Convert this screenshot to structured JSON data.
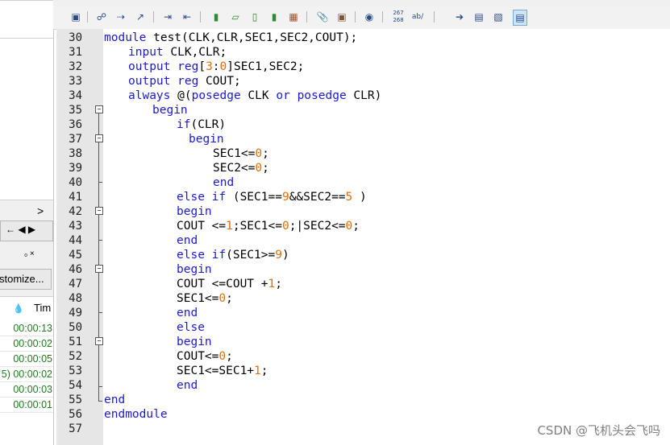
{
  "left_panel": {
    "scroll_arrow": ">",
    "panel_controls": "← ◀ ▶",
    "pin_close": "₀ ×",
    "customize_label": "stomize...",
    "column_header": "Tim",
    "times": [
      "00:00:13",
      "00:00:02",
      "00:00:05",
      "5) 00:00:02",
      "00:00:03",
      "00:00:01"
    ]
  },
  "code_lines": [
    {
      "n": "30",
      "indent": 0,
      "tokens": [
        [
          "kw",
          "module"
        ],
        [
          "t",
          " test(CLK,CLR,SEC1,SEC2,COUT);"
        ]
      ]
    },
    {
      "n": "31",
      "indent": 2,
      "tokens": [
        [
          "kw",
          "input"
        ],
        [
          "t",
          " CLK,CLR;"
        ]
      ]
    },
    {
      "n": "32",
      "indent": 2,
      "tokens": [
        [
          "kw",
          "output"
        ],
        [
          "t",
          " "
        ],
        [
          "kw",
          "reg"
        ],
        [
          "t",
          "["
        ],
        [
          "nm",
          "3"
        ],
        [
          "t",
          ":"
        ],
        [
          "nm",
          "0"
        ],
        [
          "t",
          "]SEC1,SEC2;"
        ]
      ]
    },
    {
      "n": "33",
      "indent": 2,
      "tokens": [
        [
          "kw",
          "output"
        ],
        [
          "t",
          " "
        ],
        [
          "kw",
          "reg"
        ],
        [
          "t",
          " COUT;"
        ]
      ]
    },
    {
      "n": "34",
      "indent": 2,
      "tokens": [
        [
          "kw",
          "always"
        ],
        [
          "t",
          " @("
        ],
        [
          "kw",
          "posedge"
        ],
        [
          "t",
          " CLK "
        ],
        [
          "kw",
          "or"
        ],
        [
          "t",
          " "
        ],
        [
          "kw",
          "posedge"
        ],
        [
          "t",
          " CLR)"
        ]
      ]
    },
    {
      "n": "35",
      "indent": 4,
      "tokens": [
        [
          "kw",
          "begin"
        ]
      ]
    },
    {
      "n": "36",
      "indent": 6,
      "tokens": [
        [
          "kw",
          "if"
        ],
        [
          "t",
          "(CLR)"
        ]
      ]
    },
    {
      "n": "37",
      "indent": 7,
      "tokens": [
        [
          "kw",
          "begin"
        ]
      ]
    },
    {
      "n": "38",
      "indent": 9,
      "tokens": [
        [
          "t",
          "SEC1<="
        ],
        [
          "nm",
          "0"
        ],
        [
          "t",
          ";"
        ]
      ]
    },
    {
      "n": "39",
      "indent": 9,
      "tokens": [
        [
          "t",
          "SEC2<="
        ],
        [
          "nm",
          "0"
        ],
        [
          "t",
          ";"
        ]
      ]
    },
    {
      "n": "40",
      "indent": 9,
      "tokens": [
        [
          "kw",
          "end"
        ]
      ]
    },
    {
      "n": "41",
      "indent": 6,
      "tokens": [
        [
          "kw",
          "else if"
        ],
        [
          "t",
          " (SEC1=="
        ],
        [
          "nm",
          "9"
        ],
        [
          "t",
          "&&SEC2=="
        ],
        [
          "nm",
          "5"
        ],
        [
          "t",
          " )"
        ]
      ]
    },
    {
      "n": "42",
      "indent": 6,
      "tokens": [
        [
          "kw",
          "begin"
        ]
      ]
    },
    {
      "n": "43",
      "indent": 6,
      "tokens": [
        [
          "t",
          "COUT <="
        ],
        [
          "nm",
          "1"
        ],
        [
          "t",
          ";SEC1<="
        ],
        [
          "nm",
          "0"
        ],
        [
          "t",
          ";|SEC2<="
        ],
        [
          "nm",
          "0"
        ],
        [
          "t",
          ";"
        ]
      ]
    },
    {
      "n": "44",
      "indent": 6,
      "tokens": [
        [
          "kw",
          "end"
        ]
      ]
    },
    {
      "n": "45",
      "indent": 6,
      "tokens": [
        [
          "kw",
          "else if"
        ],
        [
          "t",
          "(SEC1>="
        ],
        [
          "nm",
          "9"
        ],
        [
          "t",
          ")"
        ]
      ]
    },
    {
      "n": "46",
      "indent": 6,
      "tokens": [
        [
          "kw",
          "begin"
        ]
      ]
    },
    {
      "n": "47",
      "indent": 6,
      "tokens": [
        [
          "t",
          "COUT <=COUT +"
        ],
        [
          "nm",
          "1"
        ],
        [
          "t",
          ";"
        ]
      ]
    },
    {
      "n": "48",
      "indent": 6,
      "tokens": [
        [
          "t",
          "SEC1<="
        ],
        [
          "nm",
          "0"
        ],
        [
          "t",
          ";"
        ]
      ]
    },
    {
      "n": "49",
      "indent": 6,
      "tokens": [
        [
          "kw",
          "end"
        ]
      ]
    },
    {
      "n": "50",
      "indent": 6,
      "tokens": [
        [
          "kw",
          "else"
        ]
      ]
    },
    {
      "n": "51",
      "indent": 6,
      "tokens": [
        [
          "kw",
          "begin"
        ]
      ]
    },
    {
      "n": "52",
      "indent": 6,
      "tokens": [
        [
          "t",
          "COUT<="
        ],
        [
          "nm",
          "0"
        ],
        [
          "t",
          ";"
        ]
      ]
    },
    {
      "n": "53",
      "indent": 6,
      "tokens": [
        [
          "t",
          "SEC1<=SEC1+"
        ],
        [
          "nm",
          "1"
        ],
        [
          "t",
          ";"
        ]
      ]
    },
    {
      "n": "54",
      "indent": 6,
      "tokens": [
        [
          "kw",
          "end"
        ]
      ]
    },
    {
      "n": "55",
      "indent": 0,
      "tokens": [
        [
          "kw",
          "end"
        ]
      ]
    },
    {
      "n": "56",
      "indent": 0,
      "tokens": [
        [
          "kw",
          "endmodule"
        ]
      ]
    },
    {
      "n": "57",
      "indent": 0,
      "tokens": []
    }
  ],
  "colors": {
    "keyword": "#1a1ad6",
    "number": "#e36c0a",
    "gutter": "#e6e6e6"
  },
  "watermark": "CSDN @飞机头会飞吗"
}
